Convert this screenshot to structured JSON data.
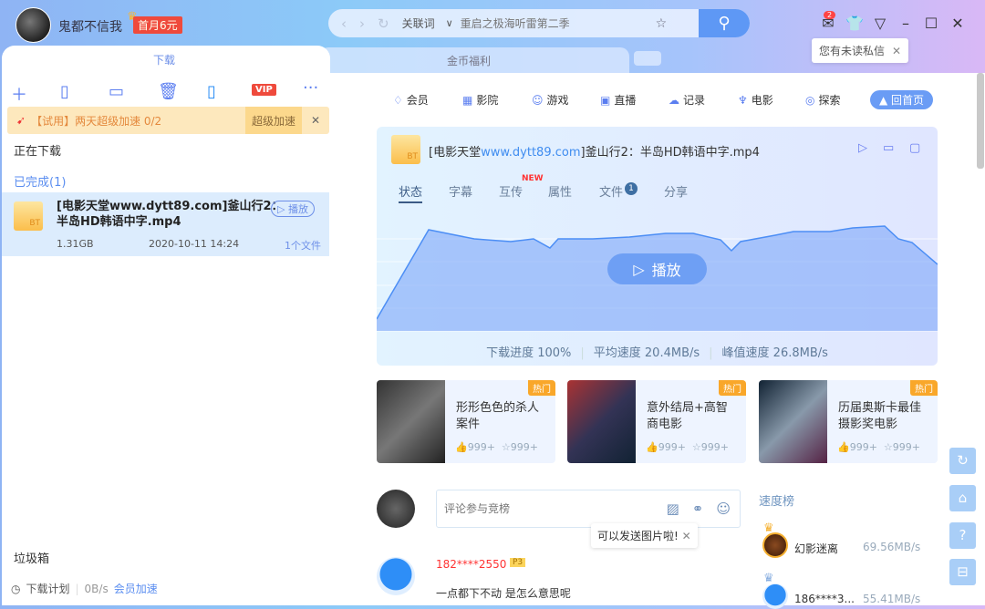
{
  "header": {
    "username": "鬼都不信我",
    "vip_promo": "首月6元",
    "search_keyword_type": "关联词",
    "search_placeholder": "重启之极海听雷第二季",
    "mail_count": "2",
    "unread_tip": "您有未读私信"
  },
  "tabs": {
    "download": "下载",
    "coins": "金币福利"
  },
  "trial": {
    "text": "【试用】两天超级加速 0/2",
    "button": "超级加速"
  },
  "sections": {
    "downloading": "正在下载",
    "completed": "已完成(1)",
    "trash": "垃圾箱"
  },
  "task": {
    "name": "[电影天堂www.dytt89.com]釜山行2：半岛HD韩语中字.mp4",
    "play": "播放",
    "size": "1.31GB",
    "date": "2020-10-11 14:24",
    "files": "1个文件"
  },
  "bottom": {
    "schedule": "下载计划",
    "speed": "0B/s",
    "vip_speed": "会员加速"
  },
  "nav": [
    "会员",
    "影院",
    "游戏",
    "直播",
    "记录",
    "电影",
    "探索"
  ],
  "home_button": "回首页",
  "detail": {
    "title_prefix": "[电影天堂",
    "title_link": "www.dytt89.com",
    "title_suffix": "]釜山行2：半岛HD韩语中字.mp4",
    "tabs": [
      "状态",
      "字幕",
      "互传",
      "属性",
      "文件",
      "分享"
    ],
    "new_badge": "NEW",
    "file_count": "1",
    "play": "播放",
    "progress": "下载进度 100%",
    "avg_speed": "平均速度 20.4MB/s",
    "peak_speed": "峰值速度 26.8MB/s"
  },
  "cards": [
    {
      "title": "形形色色的杀人案件",
      "hot": "热门",
      "likes": "999+",
      "stars": "999+"
    },
    {
      "title": "意外结局+高智商电影",
      "hot": "热门",
      "likes": "999+",
      "stars": "999+"
    },
    {
      "title": "历届奥斯卡最佳摄影奖电影",
      "hot": "热门",
      "likes": "999+",
      "stars": "999+"
    }
  ],
  "comment": {
    "placeholder": "评论参与竞榜",
    "image_tip": "可以发送图片啦!",
    "user": "182****2550",
    "level": "P3",
    "text": "一点都下不动  是怎么意思呢"
  },
  "speed_rank": {
    "title": "速度榜",
    "items": [
      {
        "rank": "1",
        "name": "幻影迷离",
        "speed": "69.56MB/s"
      },
      {
        "rank": "2",
        "name": "186****3...",
        "speed": "55.41MB/s"
      }
    ]
  },
  "colors": {
    "accent": "#5e98f5",
    "vip_red": "#ef4a3c",
    "hot_orange": "#f9a72a"
  }
}
